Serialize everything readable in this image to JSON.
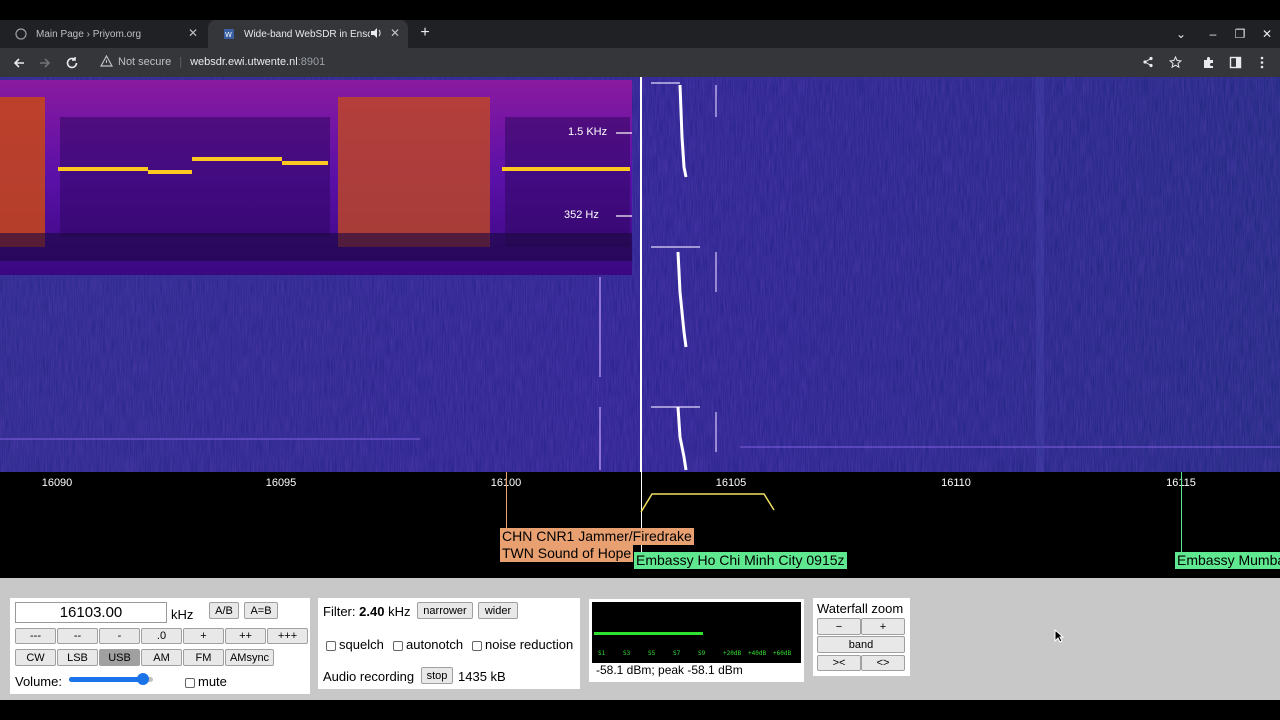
{
  "browser": {
    "tabs": [
      {
        "title": "Main Page › Priyom.org",
        "active": false
      },
      {
        "title": "Wide-band WebSDR in Enschede",
        "active": true
      }
    ],
    "address": {
      "security": "Not secure",
      "host": "websdr.ewi.utwente.nl",
      "port": ":8901"
    }
  },
  "waterfall": {
    "zoom_labels": [
      "1.5 KHz",
      "352 Hz"
    ]
  },
  "scale": {
    "ticks": [
      "16090",
      "16095",
      "16100",
      "16105",
      "16110",
      "16115"
    ],
    "station_labels": [
      {
        "text": "CHN CNR1 Jammer/Firedrake",
        "color": "#e8a070"
      },
      {
        "text": "TWN Sound of Hope",
        "color": "#e8a070"
      },
      {
        "text": "Embassy Ho Chi Minh City 0915z",
        "color": "#60e890"
      },
      {
        "text": "Embassy Mumbai",
        "color": "#60e890"
      }
    ]
  },
  "tuning": {
    "frequency": "16103.00",
    "unit": "kHz",
    "ab_label": "A/B",
    "aeqb_label": "A=B",
    "step_buttons": [
      "---",
      "--",
      "-",
      ".0",
      "+",
      "++",
      "+++"
    ],
    "modes": [
      "CW",
      "LSB",
      "USB",
      "AM",
      "FM",
      "AMsync"
    ],
    "selected_mode": "USB",
    "volume_label": "Volume:",
    "volume_level": 0.88,
    "mute_label": "mute"
  },
  "filter": {
    "label": "Filter:",
    "value": "2.40",
    "unit": "kHz",
    "narrower": "narrower",
    "wider": "wider",
    "squelch": "squelch",
    "autonotch": "autonotch",
    "noise_reduction": "noise reduction",
    "recording_label": "Audio recording",
    "stop": "stop",
    "recording_size": "1435 kB"
  },
  "smeter": {
    "scale": [
      "S1",
      "S3",
      "S5",
      "S7",
      "S9",
      "+20dB",
      "+40dB",
      "+60dB"
    ],
    "level_fraction": 0.53,
    "readout": "-58.1 dBm; peak  -58.1 dBm"
  },
  "zoom": {
    "title": "Waterfall zoom",
    "minus": "−",
    "plus": "+",
    "band": "band",
    "narrow": "><",
    "widen": "<>"
  }
}
